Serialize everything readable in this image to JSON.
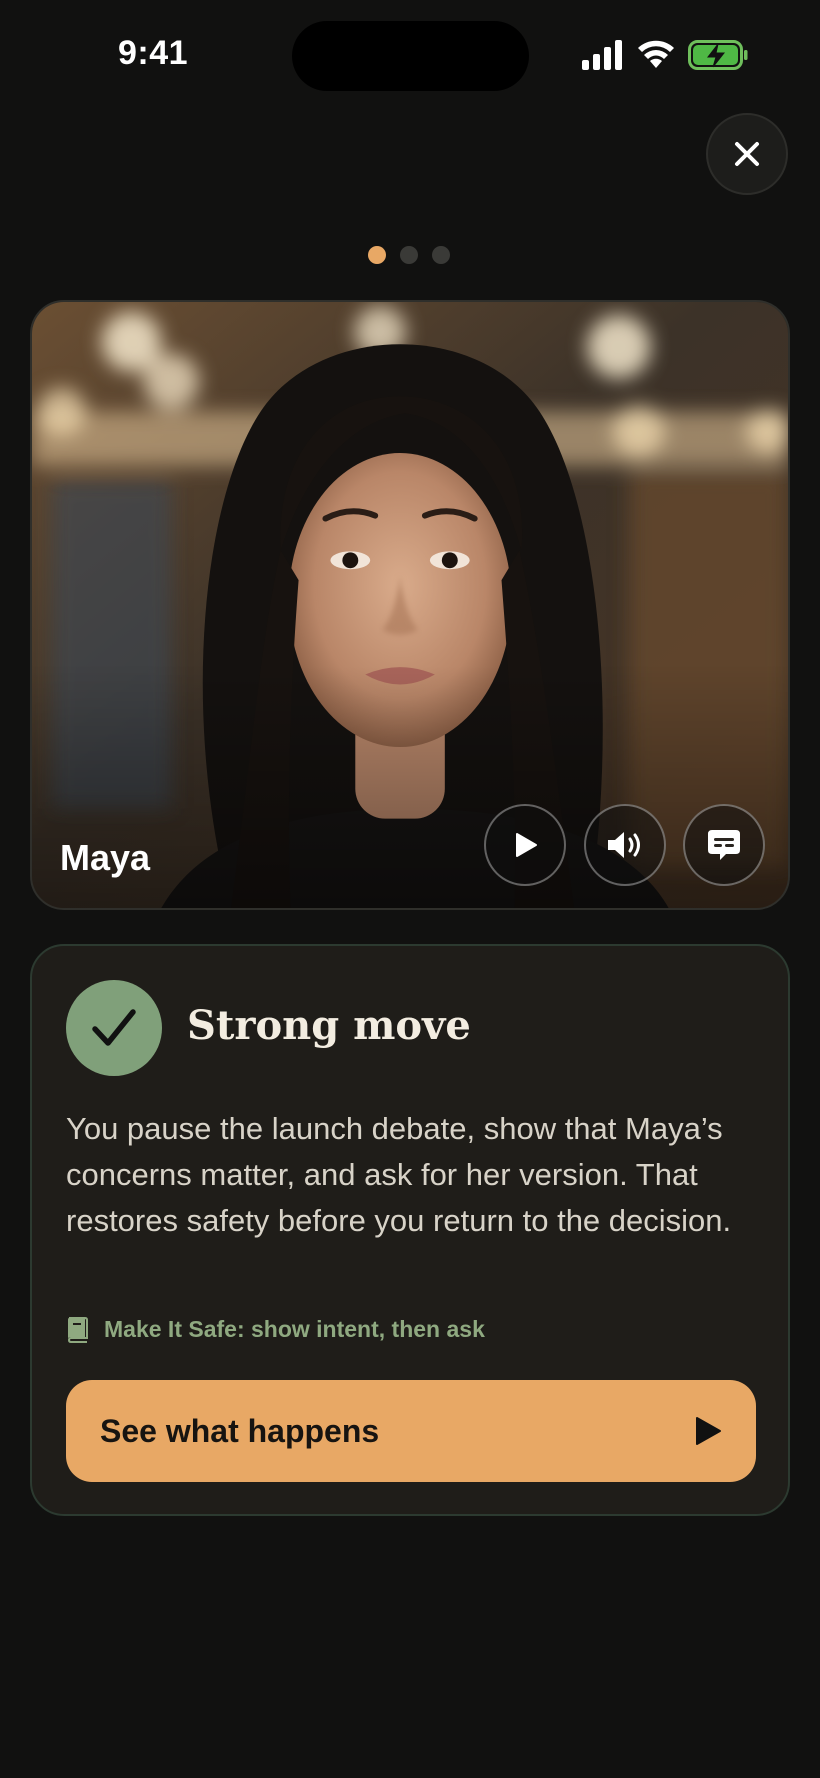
{
  "status_bar": {
    "time": "9:41",
    "icons": [
      "cellular-signal-icon",
      "wifi-icon",
      "battery-charging-icon"
    ]
  },
  "header": {
    "close_icon": "close-icon",
    "pager": {
      "total": 3,
      "current": 1
    }
  },
  "video": {
    "speaker_name": "Maya",
    "controls": [
      "play-icon",
      "volume-icon",
      "captions-icon"
    ]
  },
  "feedback": {
    "badge_icon": "checkmark-icon",
    "verdict": "Strong move",
    "explanation": "You pause the launch debate, show that Maya’s concerns matter, and ask for her version. That restores safety before you return to the decision.",
    "principle_icon": "book-icon",
    "principle": "Make It Safe: show intent, then ask",
    "cta_label": "See what happens",
    "cta_icon": "play-icon"
  },
  "colors": {
    "background": "#111110",
    "accent": "#e8a865",
    "success": "#80a07a",
    "principle_text": "#8fa980",
    "card": "#1f1d19"
  }
}
